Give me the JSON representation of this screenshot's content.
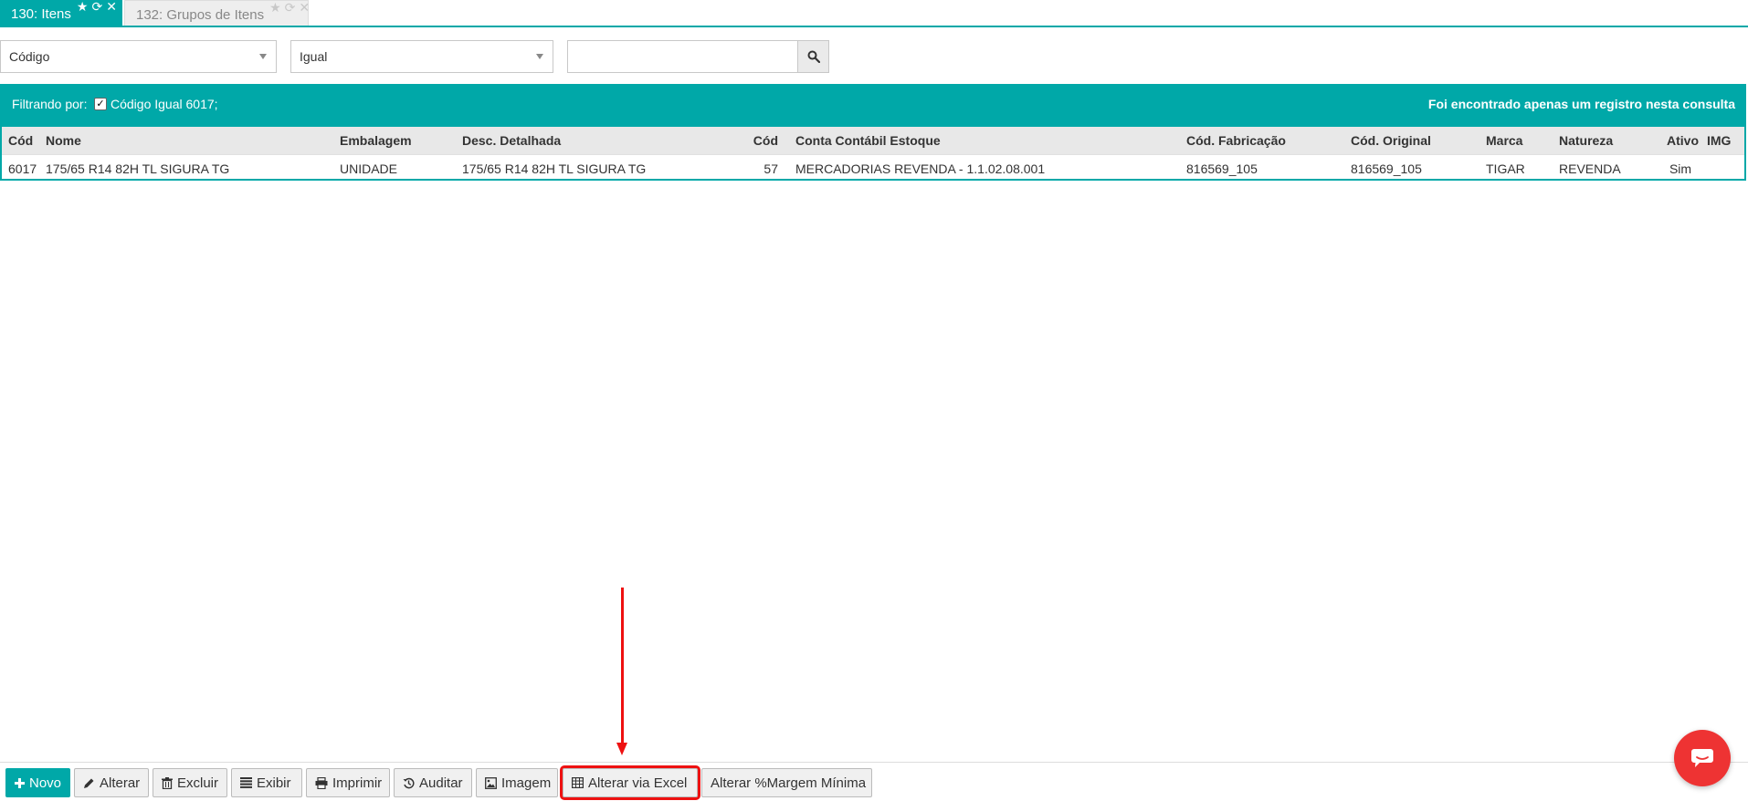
{
  "tabs": [
    {
      "label": "130: Itens",
      "active": true
    },
    {
      "label": "132: Grupos de Itens",
      "active": false
    }
  ],
  "filter": {
    "field_value": "Código",
    "operator_value": "Igual",
    "search_value": "",
    "search_placeholder": ""
  },
  "results": {
    "filter_label": "Filtrando por:",
    "filter_chip": "Código Igual 6017;",
    "count_text": "Foi encontrado apenas um registro nesta consulta",
    "columns": [
      "Cód",
      "Nome",
      "Embalagem",
      "Desc. Detalhada",
      "Cód",
      "Conta Contábil Estoque",
      "Cód. Fabricação",
      "Cód. Original",
      "Marca",
      "Natureza",
      "Ativo",
      "IMG"
    ],
    "rows": [
      {
        "cod": "6017",
        "nome": "175/65 R14 82H TL SIGURA TG",
        "embalagem": "UNIDADE",
        "desc_detalhada": "175/65 R14 82H TL SIGURA TG",
        "cod_conta": "57",
        "conta_contabil": "MERCADORIAS REVENDA - 1.1.02.08.001",
        "cod_fabricacao": "816569_105",
        "cod_original": "816569_105",
        "marca": "TIGAR",
        "natureza": "REVENDA",
        "ativo": "Sim",
        "img": ""
      }
    ]
  },
  "toolbar": {
    "novo": "Novo",
    "alterar": "Alterar",
    "excluir": "Excluir",
    "exibir": "Exibir",
    "imprimir": "Imprimir",
    "auditar": "Auditar",
    "imagem": "Imagem",
    "alterar_excel": "Alterar via Excel",
    "alterar_margem": "Alterar %Margem Mínima"
  },
  "colors": {
    "accent": "#00a8a8",
    "annotation": "#ee1111",
    "chat": "#ee3333"
  }
}
